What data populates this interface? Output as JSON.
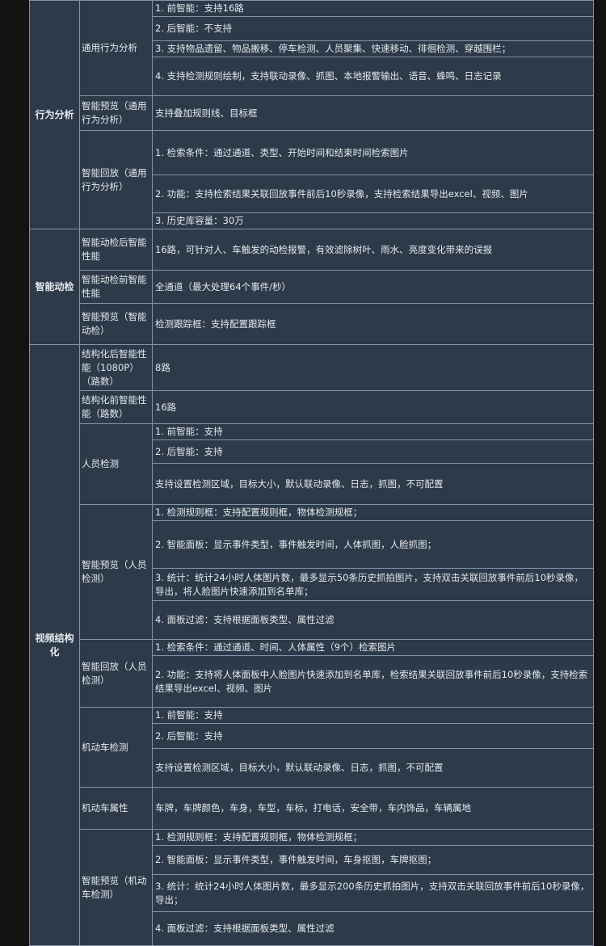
{
  "rows": [
    {
      "cat": "行为分析",
      "cat_rowspan": 8,
      "sub": "通用行为分析",
      "sub_rowspan": 4,
      "desc": "1. 前智能：支持16路",
      "h": 19
    },
    {
      "desc": "2. 后智能：不支持",
      "h": 30
    },
    {
      "desc": "3. 支持物品遗留、物品搬移、停车检测、人员聚集、快速移动、徘徊检测、穿越围栏；",
      "h": 20
    },
    {
      "desc": "4. 支持检测规则绘制，支持联动录像、抓图、本地报警输出、语音、蜂鸣、日志记录",
      "h": 48
    },
    {
      "sub": "智能预览（通用行为分析）",
      "sub_rowspan": 1,
      "desc": "支持叠加规则线、目标框",
      "h": 43
    },
    {
      "sub": "智能回放（通用行为分析）",
      "sub_rowspan": 3,
      "desc": "1. 检索条件：通过通道、类型、开始时间和结束时间检索图片",
      "h": 55
    },
    {
      "desc": "2. 功能：支持检索结果关联回放事件前后10秒录像，支持检索结果导出excel、视频、图片",
      "h": 47
    },
    {
      "desc": "3. 历史库容量：30万",
      "h": 17
    },
    {
      "cat": "智能动检",
      "cat_rowspan": 3,
      "sub": "智能动检后智能性能",
      "sub_rowspan": 1,
      "desc": "16路，可针对人、车触发的动检报警，有效滤除树叶、雨水、亮度变化带来的误报",
      "h": 51
    },
    {
      "sub": "智能动检前智能性能",
      "sub_rowspan": 1,
      "desc": "全通道（最大处理64个事件/秒）",
      "h": 41
    },
    {
      "sub": "智能预览（智能动检）",
      "sub_rowspan": 1,
      "desc": "检测跟踪框：支持配置跟踪框",
      "h": 51
    },
    {
      "cat": "视频结构化",
      "cat_rowspan": 24,
      "sub": "结构化后智能性能（1080P）（路数）",
      "sub_rowspan": 1,
      "desc": "8路",
      "h": 57
    },
    {
      "sub": "结构化前智能性能（路数）",
      "sub_rowspan": 1,
      "desc": "16路",
      "h": 41
    },
    {
      "sub": "人员检测",
      "sub_rowspan": 3,
      "desc": "1. 前智能：支持",
      "h": 19
    },
    {
      "desc": "2. 后智能：支持",
      "h": 29
    },
    {
      "desc": "支持设置检测区域，目标大小，默认联动录像、日志，抓图，不可配置",
      "h": 51
    },
    {
      "sub": "智能预览（人员检测）",
      "sub_rowspan": 4,
      "desc": "1. 检测规则框：支持配置规则框，物体检测规框；",
      "h": 20
    },
    {
      "desc": "2. 智能面板：显示事件类型，事件触发时间，人体抓图，人脸抓图；",
      "h": 59
    },
    {
      "desc": "3. 统计：统计24小时人体图片数，最多显示50条历史抓拍图片，支持双击关联回放事件前后10秒录像，导出，将人脸图片快速添加到名单库；",
      "h": 40
    },
    {
      "desc": "4. 面板过滤：支持根据面板类型、属性过滤",
      "h": 48
    },
    {
      "sub": "智能回放（人员检测）",
      "sub_rowspan": 2,
      "desc": "1. 检索条件：通过通道、时间、人体属性（9个）检索图片",
      "h": 20
    },
    {
      "desc": "2. 功能：支持将人体面板中人脸图片快速添加到名单库，检索结果关联回放事件前后10秒录像，支持检索结果导出excel、视频、图片",
      "h": 64
    },
    {
      "sub": "机动车检测",
      "sub_rowspan": 3,
      "desc": "1. 前智能：支持",
      "h": 19
    },
    {
      "desc": "2. 后智能：支持",
      "h": 31
    },
    {
      "desc": "支持设置检测区域，目标大小，默认联动录像、日志，抓图，不可配置",
      "h": 48
    },
    {
      "sub": "机动车属性",
      "sub_rowspan": 1,
      "desc": "车牌，车牌颜色，车身，车型，车标，打电话，安全带，车内饰品，车辆属地",
      "h": 52
    },
    {
      "sub": "智能预览（机动车检测）",
      "sub_rowspan": 4,
      "desc": "1. 检测规则框：支持配置规则框，物体检测规框；",
      "h": 20
    },
    {
      "desc": "2. 智能面板：显示事件类型，事件触发时间，车身抠图，车牌抠图；",
      "h": 36
    },
    {
      "desc": "3. 统计：统计24小时人体图片数，最多显示200条历史抓拍图片，支持双击关联回放事件前后10秒录像，导出；",
      "h": 46
    },
    {
      "desc": "4. 面板过滤：支持根据面板类型、属性过滤",
      "h": 42
    }
  ]
}
